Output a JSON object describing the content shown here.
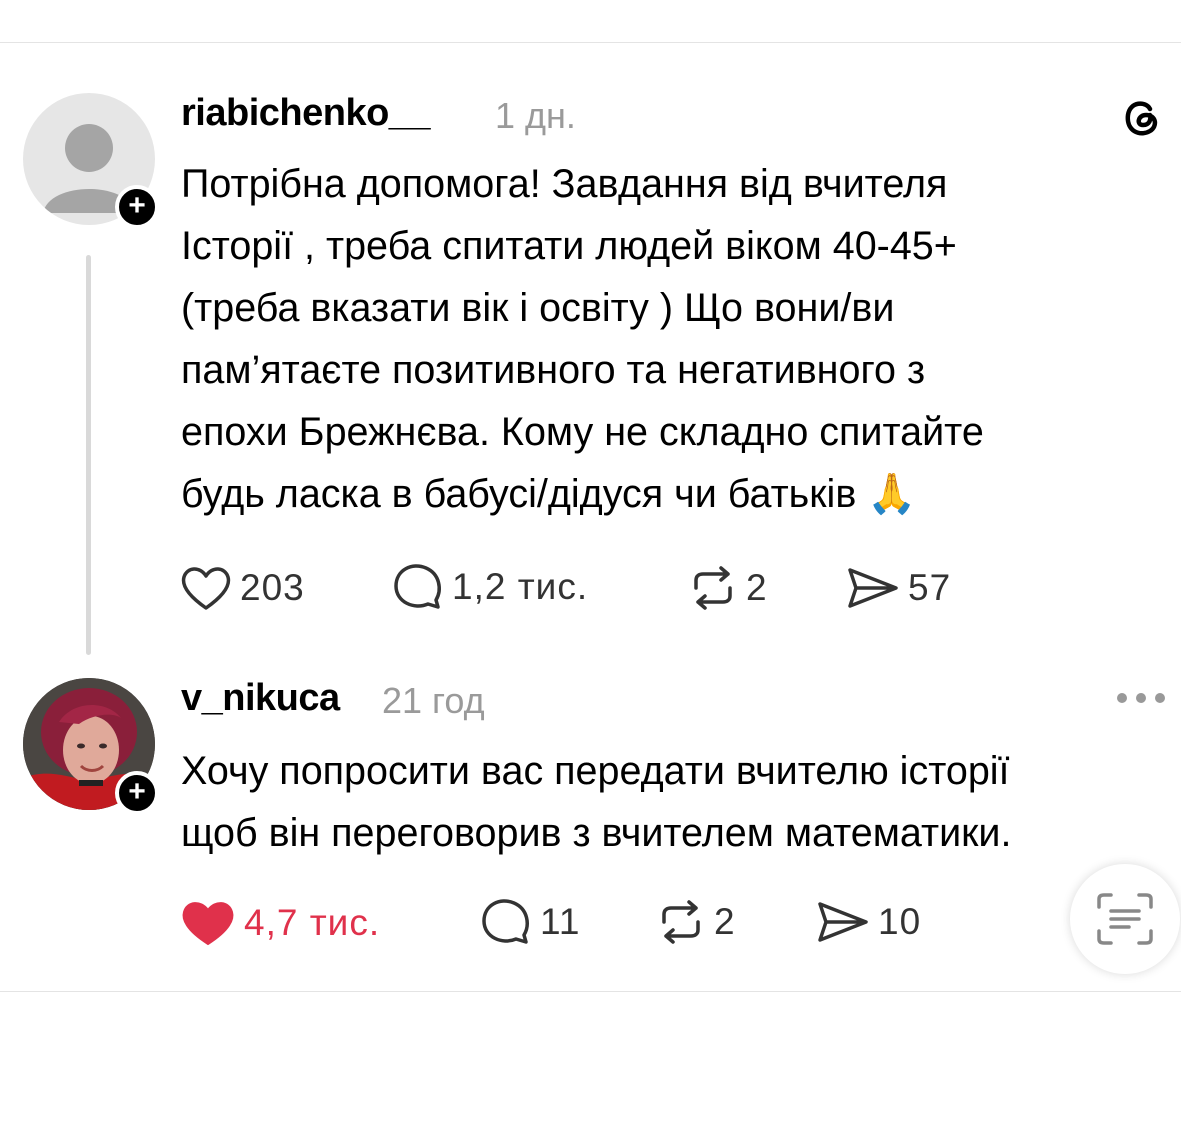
{
  "posts": [
    {
      "username": "riabichenko__",
      "time": "1 дн.",
      "text_lines": [
        "Потрібна допомога! Завдання від вчителя",
        "Історії , треба спитати людей віком 40-45+",
        "(треба вказати вік і освіту ) Що вони/ви",
        "пам’ятаєте позитивного та негативного з",
        "епохи Брежнєва. Кому не складно спитайте",
        "будь ласка в бабусі/дідуся чи батьків 🙏"
      ],
      "likes": "203",
      "replies": "1,2 тис.",
      "reposts": "2",
      "shares": "57",
      "liked": false
    },
    {
      "username": "v_nikuca",
      "time": "21 год",
      "text_lines": [
        "Хочу попросити вас передати вчителю історії",
        "щоб він переговорив з вчителем математики."
      ],
      "likes": "4,7 тис.",
      "replies": "11",
      "reposts": "2",
      "shares": "10",
      "liked": true
    }
  ],
  "icons": {
    "app_logo": "threads-logo-icon",
    "like": "heart-icon",
    "reply": "comment-bubble-icon",
    "repost": "repost-icon",
    "share": "send-icon",
    "more": "more-horizontal-icon",
    "fab": "scan-text-icon",
    "follow": "plus-icon"
  },
  "colors": {
    "liked": "#e0314b",
    "text": "#000000",
    "muted": "#9a9a9a",
    "follow_badge": "#000000"
  }
}
